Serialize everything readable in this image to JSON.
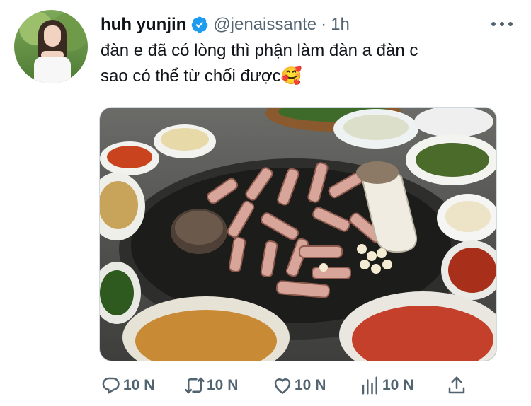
{
  "tweet": {
    "display_name": "huh yunjin",
    "handle": "@jenaissante",
    "separator": "·",
    "time": "1h",
    "text_line_1": "đàn e đã có lòng thì phận làm đàn a đàn c",
    "text_line_2": "sao có thể từ chối được",
    "emoji": "🥰"
  },
  "icons": {
    "verified": "verified-badge-icon",
    "more": "more-options-icon",
    "reply": "reply-icon",
    "retweet": "retweet-icon",
    "like": "heart-icon",
    "views": "analytics-icon",
    "share": "share-icon"
  },
  "actions": {
    "reply_count": "10 N",
    "retweet_count": "10 N",
    "like_count": "10 N",
    "views_count": "10 N"
  },
  "colors": {
    "verified": "#1d9bf0",
    "secondary_text": "#536471",
    "primary_text": "#0f1419"
  }
}
